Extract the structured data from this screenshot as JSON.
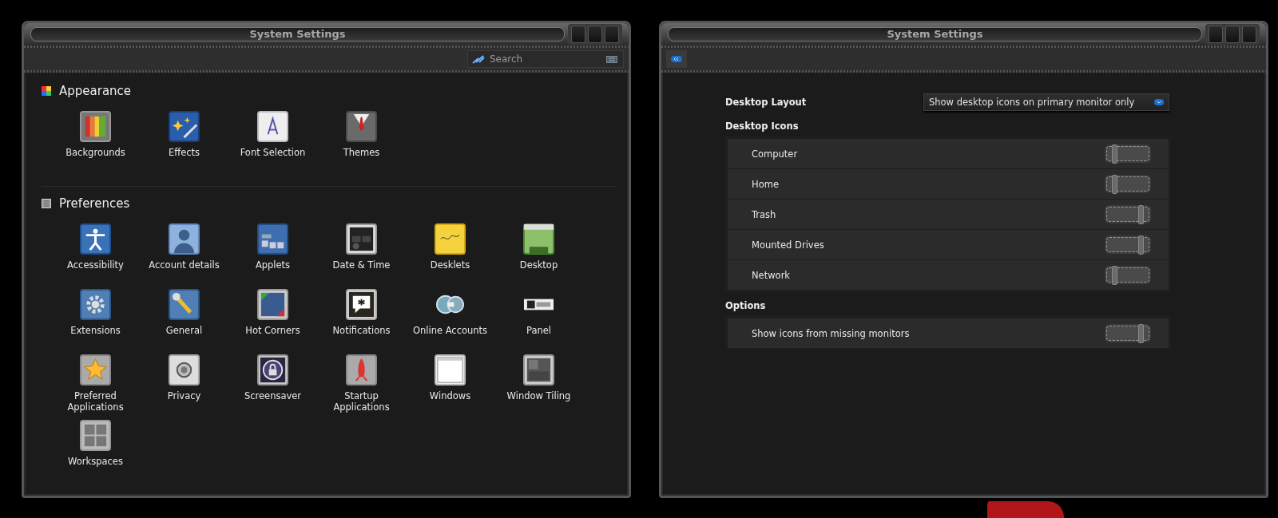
{
  "overview_window": {
    "title": "System Settings",
    "search": {
      "placeholder": "Search"
    },
    "sections": [
      {
        "title": "Appearance",
        "items": [
          {
            "label": "Backgrounds"
          },
          {
            "label": "Effects"
          },
          {
            "label": "Font Selection"
          },
          {
            "label": "Themes"
          }
        ]
      },
      {
        "title": "Preferences",
        "items": [
          {
            "label": "Accessibility"
          },
          {
            "label": "Account details"
          },
          {
            "label": "Applets"
          },
          {
            "label": "Date & Time"
          },
          {
            "label": "Desklets"
          },
          {
            "label": "Desktop"
          },
          {
            "label": "Extensions"
          },
          {
            "label": "General"
          },
          {
            "label": "Hot Corners"
          },
          {
            "label": "Notifications"
          },
          {
            "label": "Online Accounts"
          },
          {
            "label": "Panel"
          },
          {
            "label": "Preferred Applications"
          },
          {
            "label": "Privacy"
          },
          {
            "label": "Screensaver"
          },
          {
            "label": "Startup Applications"
          },
          {
            "label": "Windows"
          },
          {
            "label": "Window Tiling"
          },
          {
            "label": "Workspaces"
          }
        ]
      }
    ]
  },
  "desktop_window": {
    "title": "System Settings",
    "layout": {
      "label": "Desktop Layout",
      "value": "Show desktop icons on primary monitor only"
    },
    "groups": [
      {
        "title": "Desktop Icons",
        "rows": [
          {
            "label": "Computer",
            "on": false
          },
          {
            "label": "Home",
            "on": false
          },
          {
            "label": "Trash",
            "on": true
          },
          {
            "label": "Mounted Drives",
            "on": true
          },
          {
            "label": "Network",
            "on": false
          }
        ]
      },
      {
        "title": "Options",
        "rows": [
          {
            "label": "Show icons from missing monitors",
            "on": true
          }
        ]
      }
    ]
  }
}
